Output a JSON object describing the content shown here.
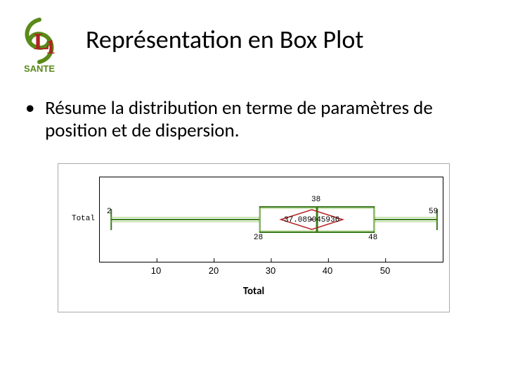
{
  "logo": {
    "top_text": "L",
    "num_text": "1",
    "bottom_text": "SANTE",
    "colors": {
      "green": "#5a8a1a",
      "red": "#b22222"
    }
  },
  "title": "Représentation en Box Plot",
  "bullet": "Résume la distribution en terme de paramètres de position et de dispersion.",
  "chart_data": {
    "type": "boxplot",
    "xlabel": "Total",
    "ylabel": "Total",
    "xticks": [
      10,
      20,
      30,
      40,
      50
    ],
    "xlim": [
      0,
      60
    ],
    "min": 2,
    "q1": 28,
    "median": 38,
    "mean": 37.089045936,
    "q3": 48,
    "max": 59,
    "annotations": {
      "min": "2",
      "q1": "28",
      "median": "38",
      "mean": "37.089045936",
      "q3": "48",
      "max": "59"
    }
  }
}
